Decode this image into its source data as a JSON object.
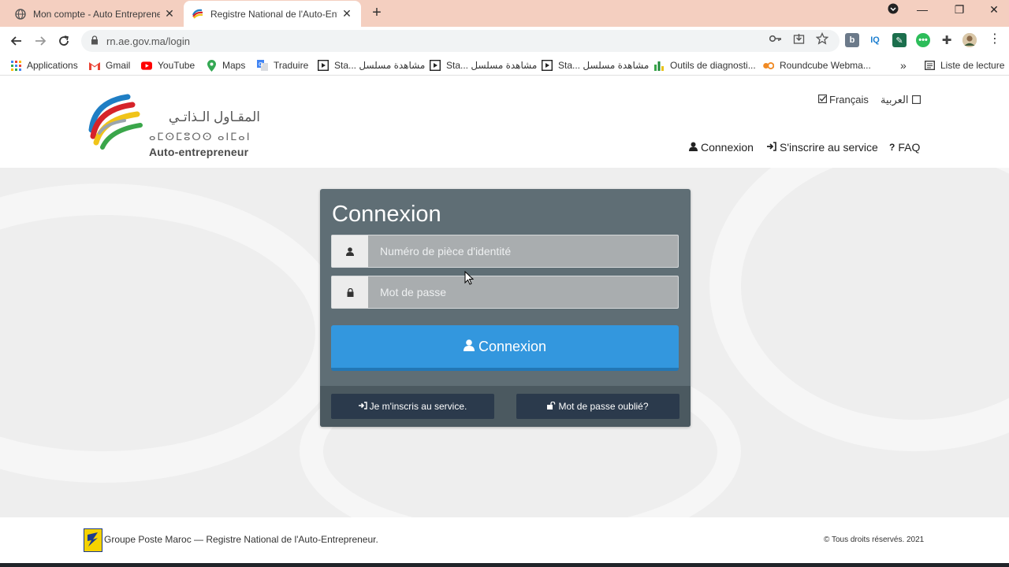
{
  "browser": {
    "tabs": [
      {
        "title": "Mon compte - Auto Entrepreneur"
      },
      {
        "title": "Registre National de l'Auto-Entrepreneur"
      }
    ],
    "url": "rn.ae.gov.ma/login",
    "bookmarks": [
      {
        "label": "Applications",
        "icon": "apps-grid-icon"
      },
      {
        "label": "Gmail",
        "icon": "gmail-icon"
      },
      {
        "label": "YouTube",
        "icon": "youtube-icon"
      },
      {
        "label": "Maps",
        "icon": "maps-pin-icon"
      },
      {
        "label": "Traduire",
        "icon": "translate-icon"
      },
      {
        "label": "Sta... مشاهدة مسلسل",
        "icon": "film-icon"
      },
      {
        "label": "Sta... مشاهدة مسلسل",
        "icon": "film-icon"
      },
      {
        "label": "Sta... مشاهدة مسلسل",
        "icon": "film-icon"
      },
      {
        "label": "Outils de diagnosti...",
        "icon": "bar-chart-icon"
      },
      {
        "label": "Roundcube Webma...",
        "icon": "roundcube-icon"
      }
    ],
    "more_bookmarks": "»",
    "reading_list": "Liste de lecture"
  },
  "site": {
    "logo": {
      "arabic": "المقـاول الـذاتـي",
      "tifinagh": "ⴰⵎⵙⵎⵓⵔⵙ ⴰⵏⵎⴰⵏ",
      "latin": "Auto-entrepreneur"
    },
    "languages": {
      "french": "Français",
      "arabic": "العربية"
    },
    "nav": {
      "login": "Connexion",
      "register": "S'inscrire au service",
      "faq": "FAQ"
    }
  },
  "login": {
    "title": "Connexion",
    "id_placeholder": "Numéro de pièce d'identité",
    "password_placeholder": "Mot de passe",
    "submit": "Connexion",
    "register_link": "Je m'inscris au service.",
    "forgot_link": "Mot de passe oublié?"
  },
  "footer": {
    "text": "Groupe Poste Maroc — Registre National de l'Auto-Entrepreneur.",
    "copyright": "© Tous droits réservés. 2021"
  },
  "colors": {
    "tabbar": "#f4cfc0",
    "panel": "#5f6e75",
    "primary_button": "#3397de",
    "secondary_button": "#2b3a4c"
  }
}
